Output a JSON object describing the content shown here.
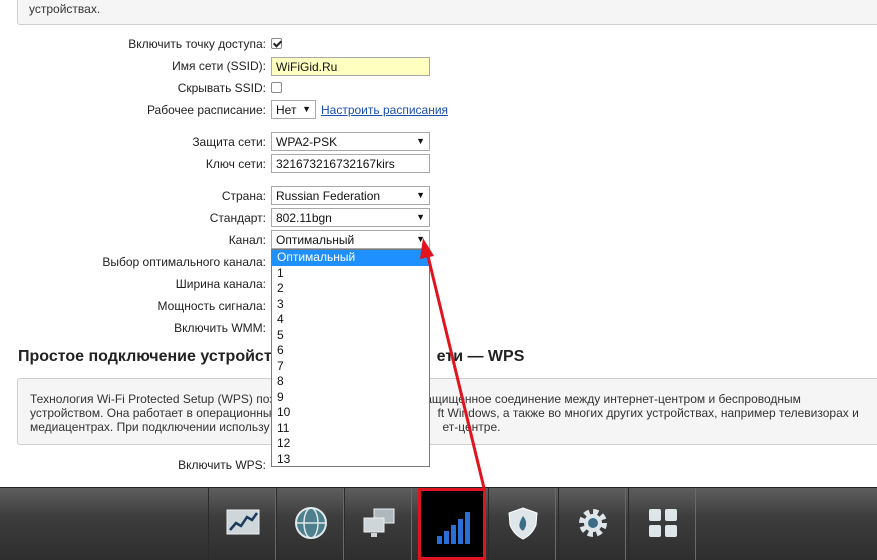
{
  "top_notice": "устройствах.",
  "form": {
    "ap_enable_label": "Включить точку доступа:",
    "ssid_label": "Имя сети (SSID):",
    "ssid_value": "WiFiGid.Ru",
    "hide_ssid_label": "Скрывать SSID:",
    "schedule_label": "Рабочее расписание:",
    "schedule_value": "Нет",
    "schedule_link": "Настроить расписания",
    "security_label": "Защита сети:",
    "security_value": "WPA2-PSK",
    "key_label": "Ключ сети:",
    "key_value": "321673216732167kirs",
    "country_label": "Страна:",
    "country_value": "Russian Federation",
    "standard_label": "Стандарт:",
    "standard_value": "802.11bgn",
    "channel_label": "Канал:",
    "channel_value": "Оптимальный",
    "optimal_channel_label": "Выбор оптимального канала:",
    "width_label": "Ширина канала:",
    "power_label": "Мощность сигнала:",
    "wmm_label": "Включить WMM:"
  },
  "channel_options": [
    "Оптимальный",
    "1",
    "2",
    "3",
    "4",
    "5",
    "6",
    "7",
    "8",
    "9",
    "10",
    "11",
    "12",
    "13"
  ],
  "wps": {
    "title_left": "Простое подключение устройст",
    "title_right": "ети — WPS",
    "desc_line1_left": "Технология Wi-Fi Protected Setup (WPS) поз",
    "desc_line1_right": "защищенное соединение между интернет-центром и беспроводным",
    "desc_line2_left": "устройством. Она работает в операционны",
    "desc_line2_right": "ft Windows, а также во многих других устройствах, например телевизорах и",
    "desc_line3_left": "медиацентрах. При подключении использу",
    "desc_line3_right": "ет-центре.",
    "enable_label": "Включить WPS:"
  },
  "taskbar": {
    "items": [
      "chart-icon",
      "globe-icon",
      "network-icon",
      "wifi-signal-icon",
      "shield-icon",
      "gear-icon",
      "apps-grid-icon"
    ],
    "active": "wifi-signal-icon"
  },
  "colors": {
    "highlight": "#1e90ff",
    "annotation": "#e0141e"
  }
}
